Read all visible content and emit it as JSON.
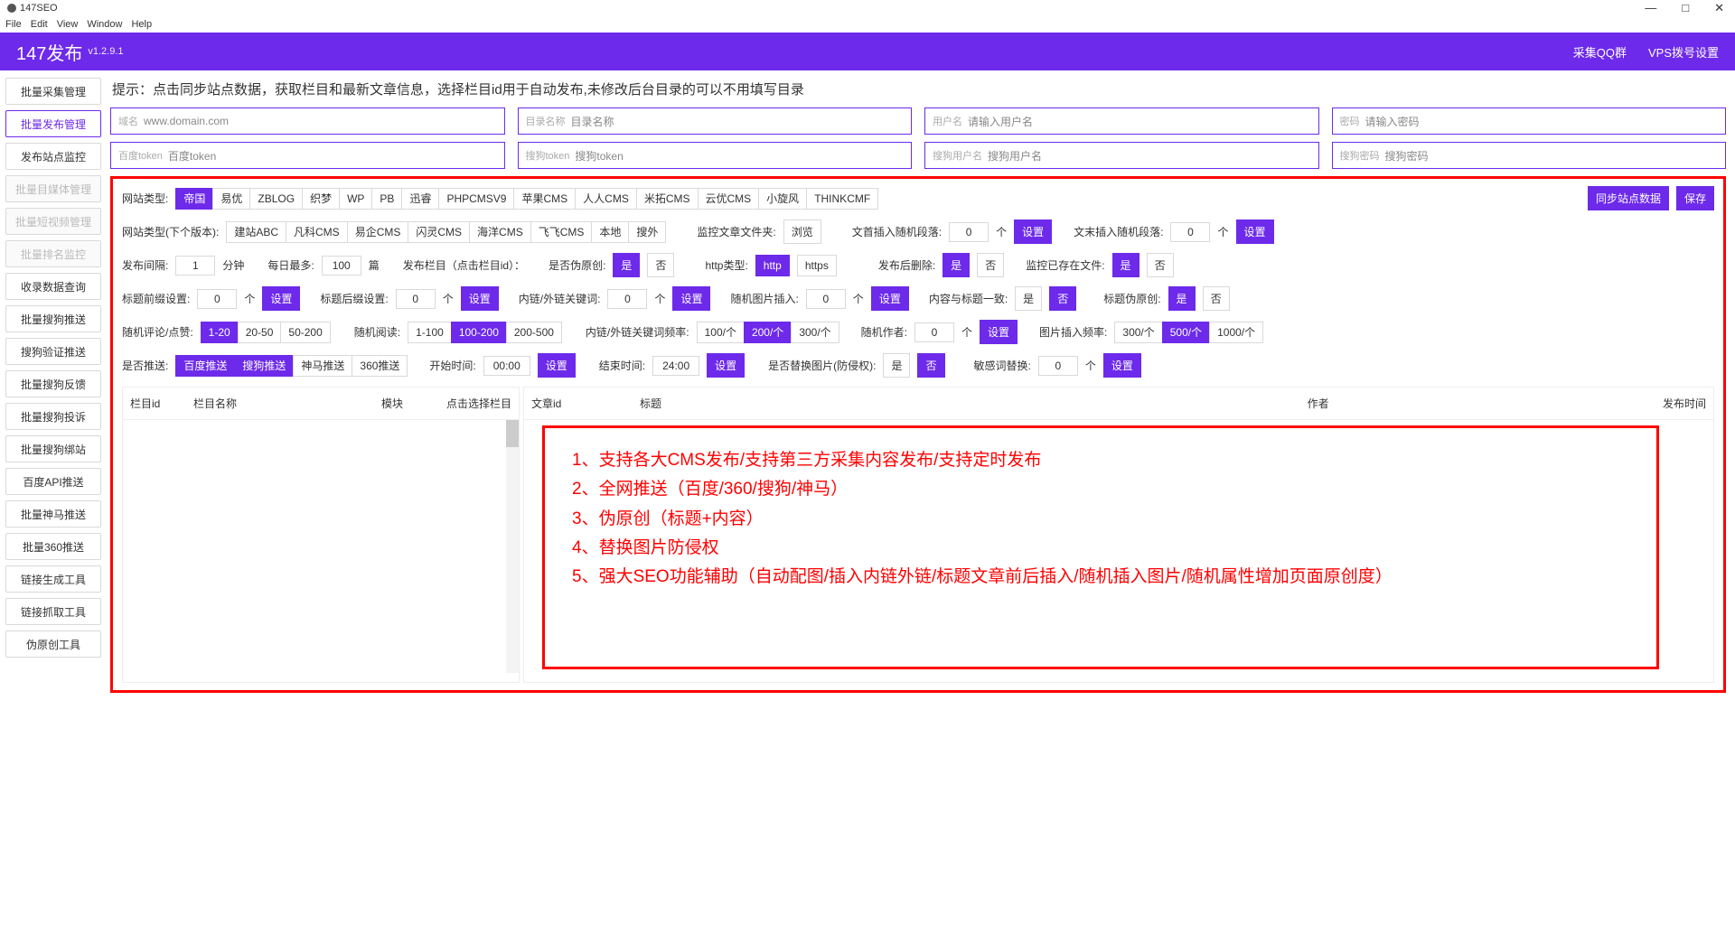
{
  "window": {
    "title": "147SEO",
    "min": "—",
    "max": "□",
    "close": "✕"
  },
  "menu": [
    "File",
    "Edit",
    "View",
    "Window",
    "Help"
  ],
  "header": {
    "title": "147发布",
    "version": "v1.2.9.1",
    "links": [
      "采集QQ群",
      "VPS拨号设置"
    ]
  },
  "sidebar": [
    {
      "label": "批量采集管理",
      "state": ""
    },
    {
      "label": "批量发布管理",
      "state": "active"
    },
    {
      "label": "发布站点监控",
      "state": ""
    },
    {
      "label": "批量目媒体管理",
      "state": "disabled"
    },
    {
      "label": "批量短视频管理",
      "state": "disabled"
    },
    {
      "label": "批量排名监控",
      "state": "disabled"
    },
    {
      "label": "收录数据查询",
      "state": ""
    },
    {
      "label": "批量搜狗推送",
      "state": ""
    },
    {
      "label": "搜狗验证推送",
      "state": ""
    },
    {
      "label": "批量搜狗反馈",
      "state": ""
    },
    {
      "label": "批量搜狗投诉",
      "state": ""
    },
    {
      "label": "批量搜狗绑站",
      "state": ""
    },
    {
      "label": "百度API推送",
      "state": ""
    },
    {
      "label": "批量神马推送",
      "state": ""
    },
    {
      "label": "批量360推送",
      "state": ""
    },
    {
      "label": "链接生成工具",
      "state": ""
    },
    {
      "label": "链接抓取工具",
      "state": ""
    },
    {
      "label": "伪原创工具",
      "state": ""
    }
  ],
  "tip": "提示：点击同步站点数据，获取栏目和最新文章信息，选择栏目id用于自动发布,未修改后台目录的可以不用填写目录",
  "inputs": [
    [
      {
        "l": "域名",
        "p": "www.domain.com"
      },
      {
        "l": "目录名称",
        "p": "目录名称"
      },
      {
        "l": "用户名",
        "p": "请输入用户名"
      },
      {
        "l": "密码",
        "p": "请输入密码"
      }
    ],
    [
      {
        "l": "百度token",
        "p": "百度token"
      },
      {
        "l": "搜狗token",
        "p": "搜狗token"
      },
      {
        "l": "搜狗用户名",
        "p": "搜狗用户名"
      },
      {
        "l": "搜狗密码",
        "p": "搜狗密码"
      }
    ]
  ],
  "cms": {
    "label": "网站类型:",
    "items": [
      "帝国",
      "易优",
      "ZBLOG",
      "织梦",
      "WP",
      "PB",
      "迅睿",
      "PHPCMSV9",
      "苹果CMS",
      "人人CMS",
      "米拓CMS",
      "云优CMS",
      "小旋风",
      "THINKCMF"
    ],
    "active": 0
  },
  "actions": {
    "sync": "同步站点数据",
    "save": "保存"
  },
  "cmsNext": {
    "label": "网站类型(下个版本):",
    "items": [
      "建站ABC",
      "凡科CMS",
      "易企CMS",
      "闪灵CMS",
      "海洋CMS",
      "飞飞CMS",
      "本地",
      "搜外"
    ]
  },
  "cmsNext2": {
    "monitorLabel": "监控文章文件夹:",
    "browse": "浏览",
    "frontLabel": "文首插入随机段落:",
    "frontVal": "0",
    "frontUnit": "个",
    "endLabel": "文末插入随机段落:",
    "endVal": "0",
    "endUnit": "个",
    "set": "设置"
  },
  "row3": {
    "intervalLabel": "发布间隔:",
    "intervalVal": "1",
    "intervalUnit": "分钟",
    "dailyLabel": "每日最多:",
    "dailyVal": "100",
    "dailyUnit": "篇",
    "colLabel": "发布栏目（点击栏目id）：",
    "pseudoLabel": "是否伪原创:",
    "yes": "是",
    "no": "否",
    "httpLabel": "http类型:",
    "http": "http",
    "https": "https",
    "delLabel": "发布后删除:",
    "existsLabel": "监控已存在文件:"
  },
  "row4": {
    "prefixLabel": "标题前缀设置:",
    "val0": "0",
    "unit": "个",
    "set": "设置",
    "suffixLabel": "标题后缀设置:",
    "linkLabel": "内链/外链关键词:",
    "imgLabel": "随机图片插入:",
    "titleMatchLabel": "内容与标题一致:",
    "yes": "是",
    "no": "否",
    "pseudoTitleLabel": "标题伪原创:"
  },
  "row5": {
    "commentLabel": "随机评论/点赞:",
    "c": [
      "1-20",
      "20-50",
      "50-200"
    ],
    "cActive": 0,
    "readLabel": "随机阅读:",
    "r": [
      "1-100",
      "100-200",
      "200-500"
    ],
    "rActive": 1,
    "linkFreqLabel": "内链/外链关键词频率:",
    "f": [
      "100/个",
      "200/个",
      "300/个"
    ],
    "fActive": 1,
    "authorLabel": "随机作者:",
    "val0": "0",
    "unit": "个",
    "set": "设置",
    "imgFreqLabel": "图片插入频率:",
    "i": [
      "300/个",
      "500/个",
      "1000/个"
    ],
    "iActive": 1
  },
  "row6": {
    "pushLabel": "是否推送:",
    "p": [
      "百度推送",
      "搜狗推送",
      "神马推送",
      "360推送"
    ],
    "startLabel": "开始时间:",
    "startVal": "00:00",
    "endLabel": "结束时间:",
    "endVal": "24:00",
    "set": "设置",
    "replaceImgLabel": "是否替换图片(防侵权):",
    "yes": "是",
    "no": "否",
    "sensLabel": "敏感词替换:",
    "val0": "0",
    "unit": "个"
  },
  "tableL": {
    "h": [
      "栏目id",
      "栏目名称",
      "模块",
      "点击选择栏目"
    ]
  },
  "tableR": {
    "h": [
      "文章id",
      "标题",
      "作者",
      "发布时间"
    ]
  },
  "features": [
    "1、支持各大CMS发布/支持第三方采集内容发布/支持定时发布",
    "2、全网推送（百度/360/搜狗/神马）",
    "3、伪原创（标题+内容）",
    "4、替换图片防侵权",
    "5、强大SEO功能辅助（自动配图/插入内链外链/标题文章前后插入/随机插入图片/随机属性增加页面原创度）"
  ]
}
